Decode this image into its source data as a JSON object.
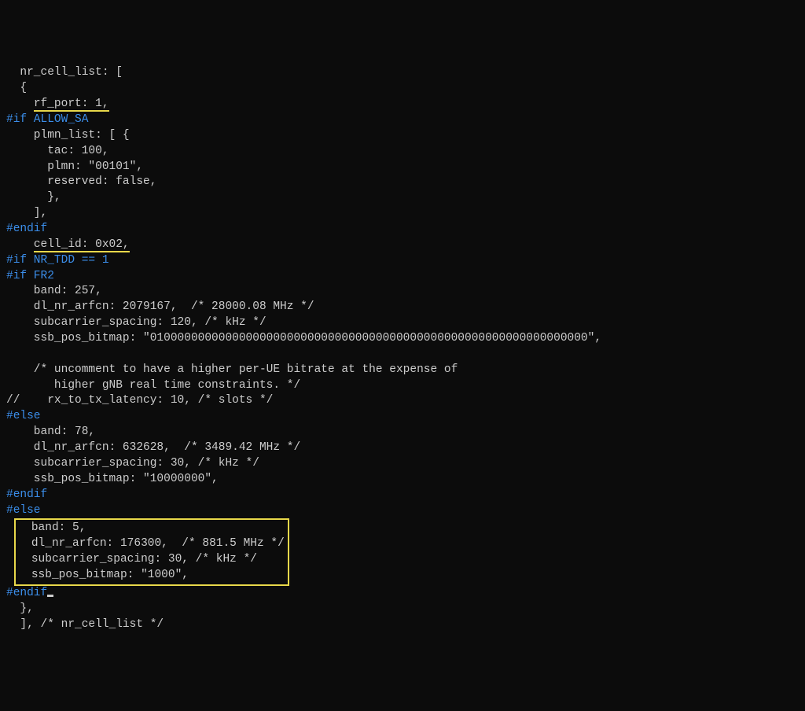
{
  "l1": "  nr_cell_list: [",
  "l2": "  {",
  "l3a": "    ",
  "l3b": "rf_port: 1,",
  "l4": "#if ALLOW_SA",
  "l5": "    plmn_list: [ {",
  "l6": "      tac: 100,",
  "l7": "      plmn: \"00101\",",
  "l8": "      reserved: false,",
  "l9": "      },",
  "l10": "    ],",
  "l11": "#endif",
  "l12a": "    ",
  "l12b": "cell_id: 0x02,",
  "l13": "#if NR_TDD == 1",
  "l14": "#if FR2",
  "l15": "    band: 257,",
  "l16": "    dl_nr_arfcn: 2079167,  /* 28000.08 MHz */",
  "l17": "    subcarrier_spacing: 120, /* kHz */",
  "l18": "    ssb_pos_bitmap: \"0100000000000000000000000000000000000000000000000000000000000000\",",
  "l19": "",
  "l20": "    /* uncomment to have a higher per-UE bitrate at the expense of",
  "l21": "       higher gNB real time constraints. */",
  "l22": "//    rx_to_tx_latency: 10, /* slots */",
  "l23": "#else",
  "l24": "    band: 78,",
  "l25": "    dl_nr_arfcn: 632628,  /* 3489.42 MHz */",
  "l26": "    subcarrier_spacing: 30, /* kHz */",
  "l27": "    ssb_pos_bitmap: \"10000000\",",
  "l28": "#endif",
  "l29": "#else",
  "box1": "  band: 5,",
  "box2": "  dl_nr_arfcn: 176300,  /* 881.5 MHz */",
  "box3": "  subcarrier_spacing: 30, /* kHz */",
  "box4": "  ssb_pos_bitmap: \"1000\",",
  "l34": "#endif",
  "l35": "  },",
  "l36": "  ], /* nr_cell_list */"
}
